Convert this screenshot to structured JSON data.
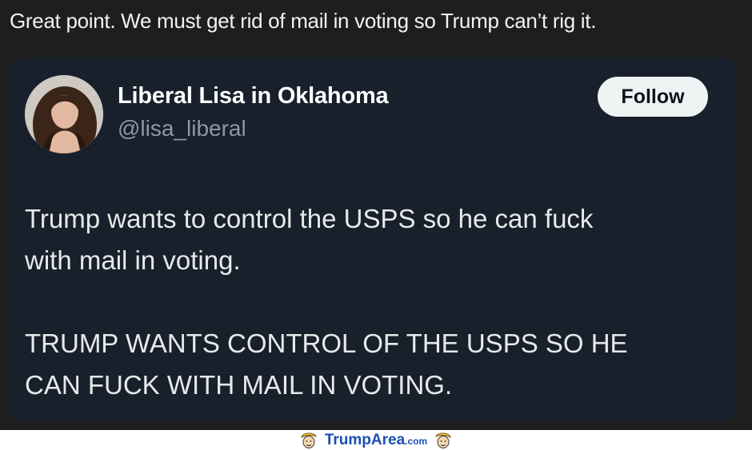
{
  "reply": {
    "text": "Great point. We must get rid of mail in voting so Trump can’t rig it."
  },
  "tweet": {
    "display_name": "Liberal Lisa in Oklahoma",
    "handle": "@lisa_liberal",
    "follow_label": "Follow",
    "body": [
      "Trump wants to control the USPS so he can fuck\nwith mail in voting.",
      "TRUMP WANTS CONTROL OF THE USPS SO HE\nCAN FUCK WITH MAIL IN VOTING."
    ]
  },
  "watermark": {
    "brand": "TrumpArea",
    "suffix": ".com",
    "icon": "trump-face-icon"
  },
  "colors": {
    "screen_bg": "#1e1e1e",
    "card_bg": "#17202b",
    "handle_gray": "#8b98a5",
    "follow_bg": "#eff3f4",
    "brand_blue": "#1c4fb5"
  }
}
